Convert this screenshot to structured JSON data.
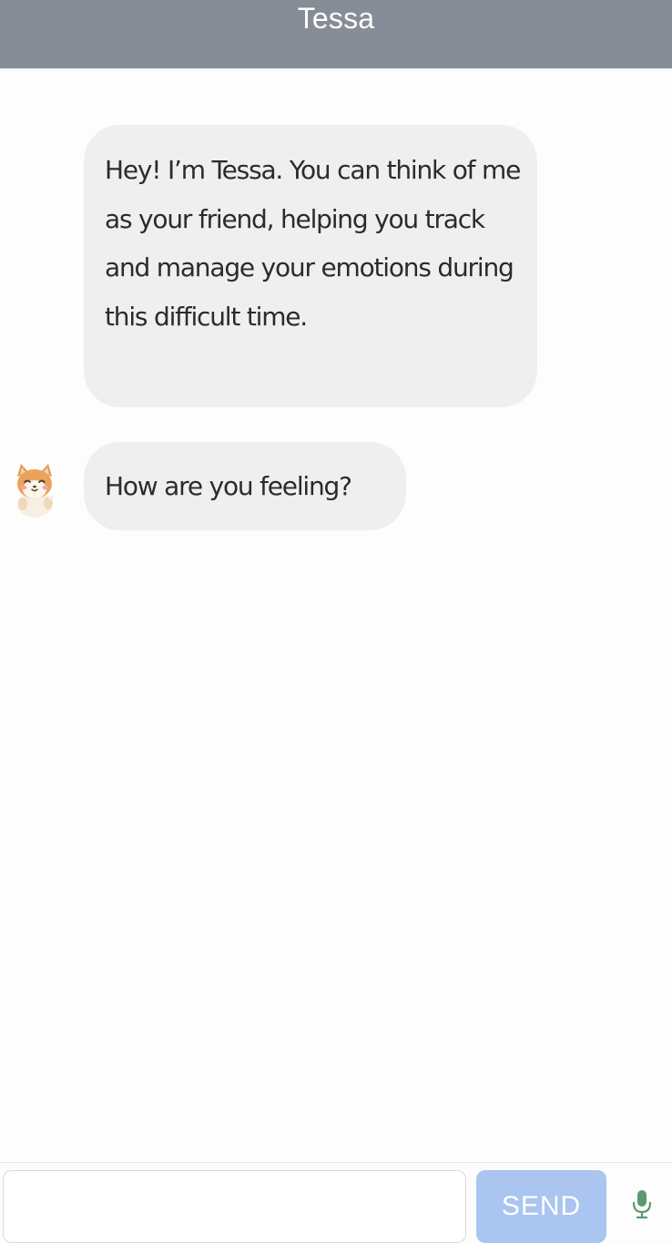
{
  "header": {
    "title": "Tessa",
    "background_color": "#878d97"
  },
  "messages": [
    {
      "sender": "Tessa",
      "text": "Hey! I’m Tessa. You can think of me as your friend, helping you track and manage your emotions during this difficult time.",
      "show_avatar": false
    },
    {
      "sender": "Tessa",
      "text": "How are you feeling?",
      "show_avatar": true,
      "avatar_icon": "shiba-dog-avatar-icon"
    }
  ],
  "composer": {
    "input_value": "",
    "input_placeholder": "",
    "send_label": "SEND",
    "send_color": "#a9c5f0",
    "mic_icon": "microphone-icon",
    "mic_color": "#5a9a6e"
  },
  "colors": {
    "bubble_background": "#efefef",
    "page_background": "#fdfdfd"
  }
}
